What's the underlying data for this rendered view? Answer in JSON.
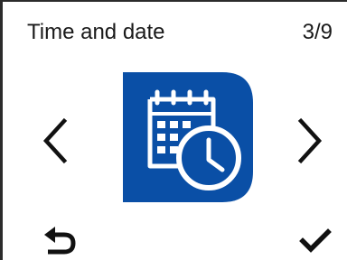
{
  "header": {
    "title": "Time and date",
    "page_indicator": "3/9"
  },
  "menu_item": {
    "icon": "calendar-clock-icon",
    "tile_color": "#0a4fa6"
  },
  "navigation": {
    "prev_icon": "chevron-left-icon",
    "next_icon": "chevron-right-icon",
    "back_icon": "back-arrow-icon",
    "confirm_icon": "checkmark-icon"
  }
}
